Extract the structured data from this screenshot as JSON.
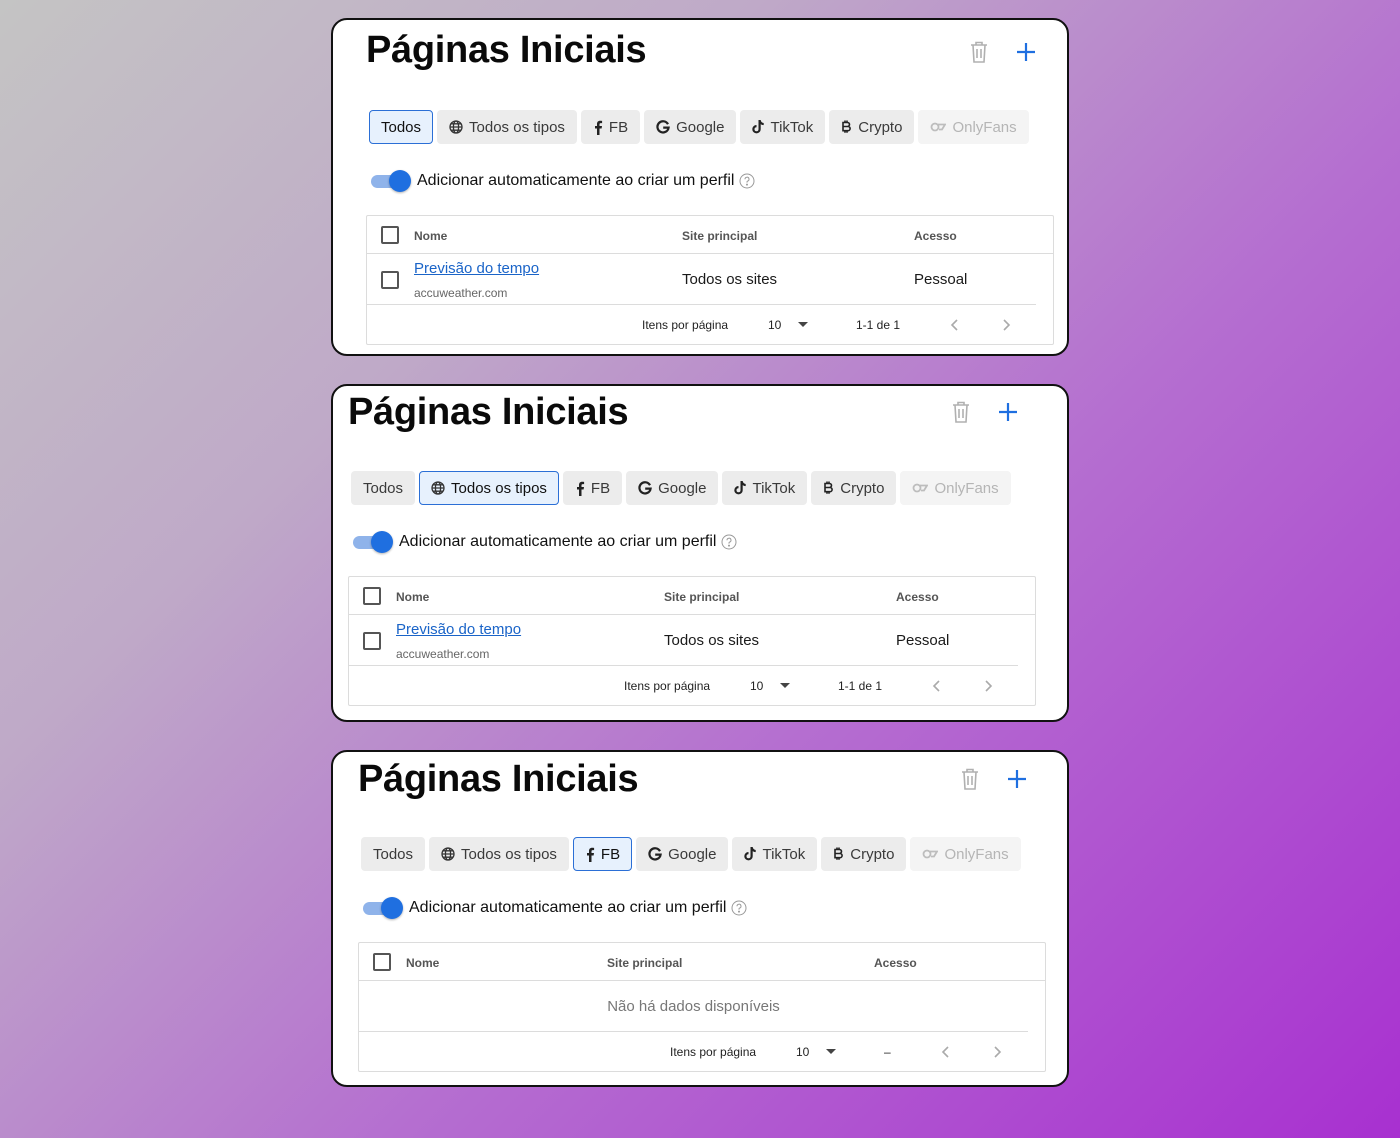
{
  "panels": [
    {
      "title": "Páginas Iniciais",
      "tabs": [
        {
          "label": "Todos",
          "icon": "",
          "state": "active"
        },
        {
          "label": "Todos os tipos",
          "icon": "globe-icon",
          "state": "normal"
        },
        {
          "label": "FB",
          "icon": "facebook-icon",
          "state": "normal"
        },
        {
          "label": "Google",
          "icon": "google-icon",
          "state": "normal"
        },
        {
          "label": "TikTok",
          "icon": "tiktok-icon",
          "state": "normal"
        },
        {
          "label": "Crypto",
          "icon": "bitcoin-icon",
          "state": "normal"
        },
        {
          "label": "OnlyFans",
          "icon": "onlyfans-icon",
          "state": "disabled"
        }
      ],
      "toggle_label": "Adicionar automaticamente ao criar um perfil",
      "toggle_on": true,
      "columns": {
        "name": "Nome",
        "site": "Site principal",
        "access": "Acesso"
      },
      "rows": [
        {
          "name": "Previsão do tempo",
          "domain": "accuweather.com",
          "site": "Todos os sites",
          "access": "Pessoal"
        }
      ],
      "empty_text": "",
      "pager": {
        "label": "Itens por página",
        "per_page": "10",
        "range": "1-1 de 1"
      }
    },
    {
      "title": "Páginas Iniciais",
      "tabs": [
        {
          "label": "Todos",
          "icon": "",
          "state": "normal"
        },
        {
          "label": "Todos os tipos",
          "icon": "globe-icon",
          "state": "active"
        },
        {
          "label": "FB",
          "icon": "facebook-icon",
          "state": "normal"
        },
        {
          "label": "Google",
          "icon": "google-icon",
          "state": "normal"
        },
        {
          "label": "TikTok",
          "icon": "tiktok-icon",
          "state": "normal"
        },
        {
          "label": "Crypto",
          "icon": "bitcoin-icon",
          "state": "normal"
        },
        {
          "label": "OnlyFans",
          "icon": "onlyfans-icon",
          "state": "disabled"
        }
      ],
      "toggle_label": "Adicionar automaticamente ao criar um perfil",
      "toggle_on": true,
      "columns": {
        "name": "Nome",
        "site": "Site principal",
        "access": "Acesso"
      },
      "rows": [
        {
          "name": "Previsão do tempo",
          "domain": "accuweather.com",
          "site": "Todos os sites",
          "access": "Pessoal"
        }
      ],
      "empty_text": "",
      "pager": {
        "label": "Itens por página",
        "per_page": "10",
        "range": "1-1 de 1"
      }
    },
    {
      "title": "Páginas Iniciais",
      "tabs": [
        {
          "label": "Todos",
          "icon": "",
          "state": "normal"
        },
        {
          "label": "Todos os tipos",
          "icon": "globe-icon",
          "state": "normal"
        },
        {
          "label": "FB",
          "icon": "facebook-icon",
          "state": "active"
        },
        {
          "label": "Google",
          "icon": "google-icon",
          "state": "normal"
        },
        {
          "label": "TikTok",
          "icon": "tiktok-icon",
          "state": "normal"
        },
        {
          "label": "Crypto",
          "icon": "bitcoin-icon",
          "state": "normal"
        },
        {
          "label": "OnlyFans",
          "icon": "onlyfans-icon",
          "state": "disabled"
        }
      ],
      "toggle_label": "Adicionar automaticamente ao criar um perfil",
      "toggle_on": true,
      "columns": {
        "name": "Nome",
        "site": "Site principal",
        "access": "Acesso"
      },
      "rows": [],
      "empty_text": "Não há dados disponíveis",
      "pager": {
        "label": "Itens por página",
        "per_page": "10",
        "range": "–"
      }
    }
  ],
  "colors": {
    "accent": "#1f6fe0",
    "link": "#1a64c8",
    "active_tab_bg": "#e7f1fd",
    "tab_bg": "#ececec"
  }
}
